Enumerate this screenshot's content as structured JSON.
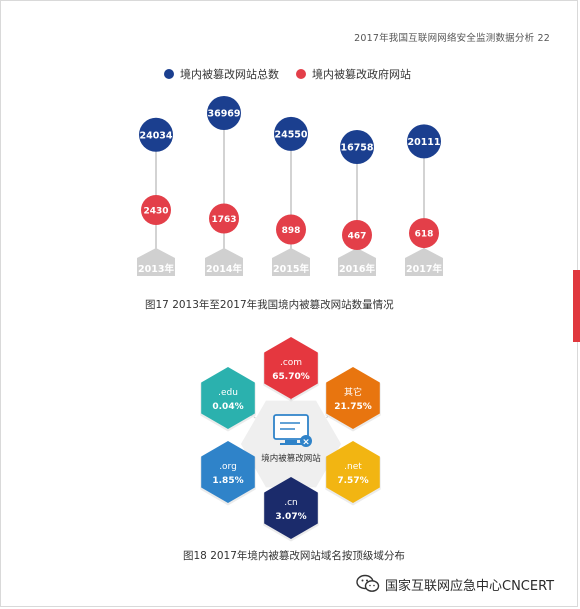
{
  "header": {
    "text": "2017年我国互联网网络安全监测数据分析   22"
  },
  "chart_data": [
    {
      "type": "lollipop",
      "legend": [
        {
          "name": "境内被篡改网站总数",
          "color": "#1b3f8f"
        },
        {
          "name": "境内被篡改政府网站",
          "color": "#e33f49"
        }
      ],
      "legend_position": "top",
      "categories": [
        "2013年",
        "2014年",
        "2015年",
        "2016年",
        "2017年"
      ],
      "series": [
        {
          "name": "境内被篡改网站总数",
          "values": [
            24034,
            36969,
            24550,
            16758,
            20111
          ],
          "labels": [
            "24034",
            "36969",
            "24550",
            "16758",
            "20111"
          ]
        },
        {
          "name": "境内被篡改政府网站",
          "values": [
            2430,
            1763,
            898,
            467,
            618
          ],
          "labels": [
            "2430",
            "1763",
            "898",
            "467",
            "618"
          ]
        }
      ],
      "title": "图17 2013年至2017年我国境内被篡改网站数量情况"
    },
    {
      "type": "pie",
      "center_label": "境内被篡改网站",
      "segments": [
        {
          "domain": ".com",
          "value": 65.7,
          "label": "65.70%",
          "color": "#e5373f"
        },
        {
          "domain": "其它",
          "value": 21.75,
          "label": "21.75%",
          "color": "#e8750f"
        },
        {
          "domain": ".net",
          "value": 7.57,
          "label": "7.57%",
          "color": "#f2b512"
        },
        {
          "domain": ".cn",
          "value": 3.07,
          "label": "3.07%",
          "color": "#1b2b6b"
        },
        {
          "domain": ".org",
          "value": 1.85,
          "label": "1.85%",
          "color": "#2f83c9"
        },
        {
          "domain": ".edu",
          "value": 0.04,
          "label": "0.04%",
          "color": "#2bb1ae"
        }
      ],
      "title": "图18 2017年境内被篡改网站域名按顶级域分布"
    }
  ],
  "watermark": {
    "text": "国家互联网应急中心CNCERT"
  }
}
